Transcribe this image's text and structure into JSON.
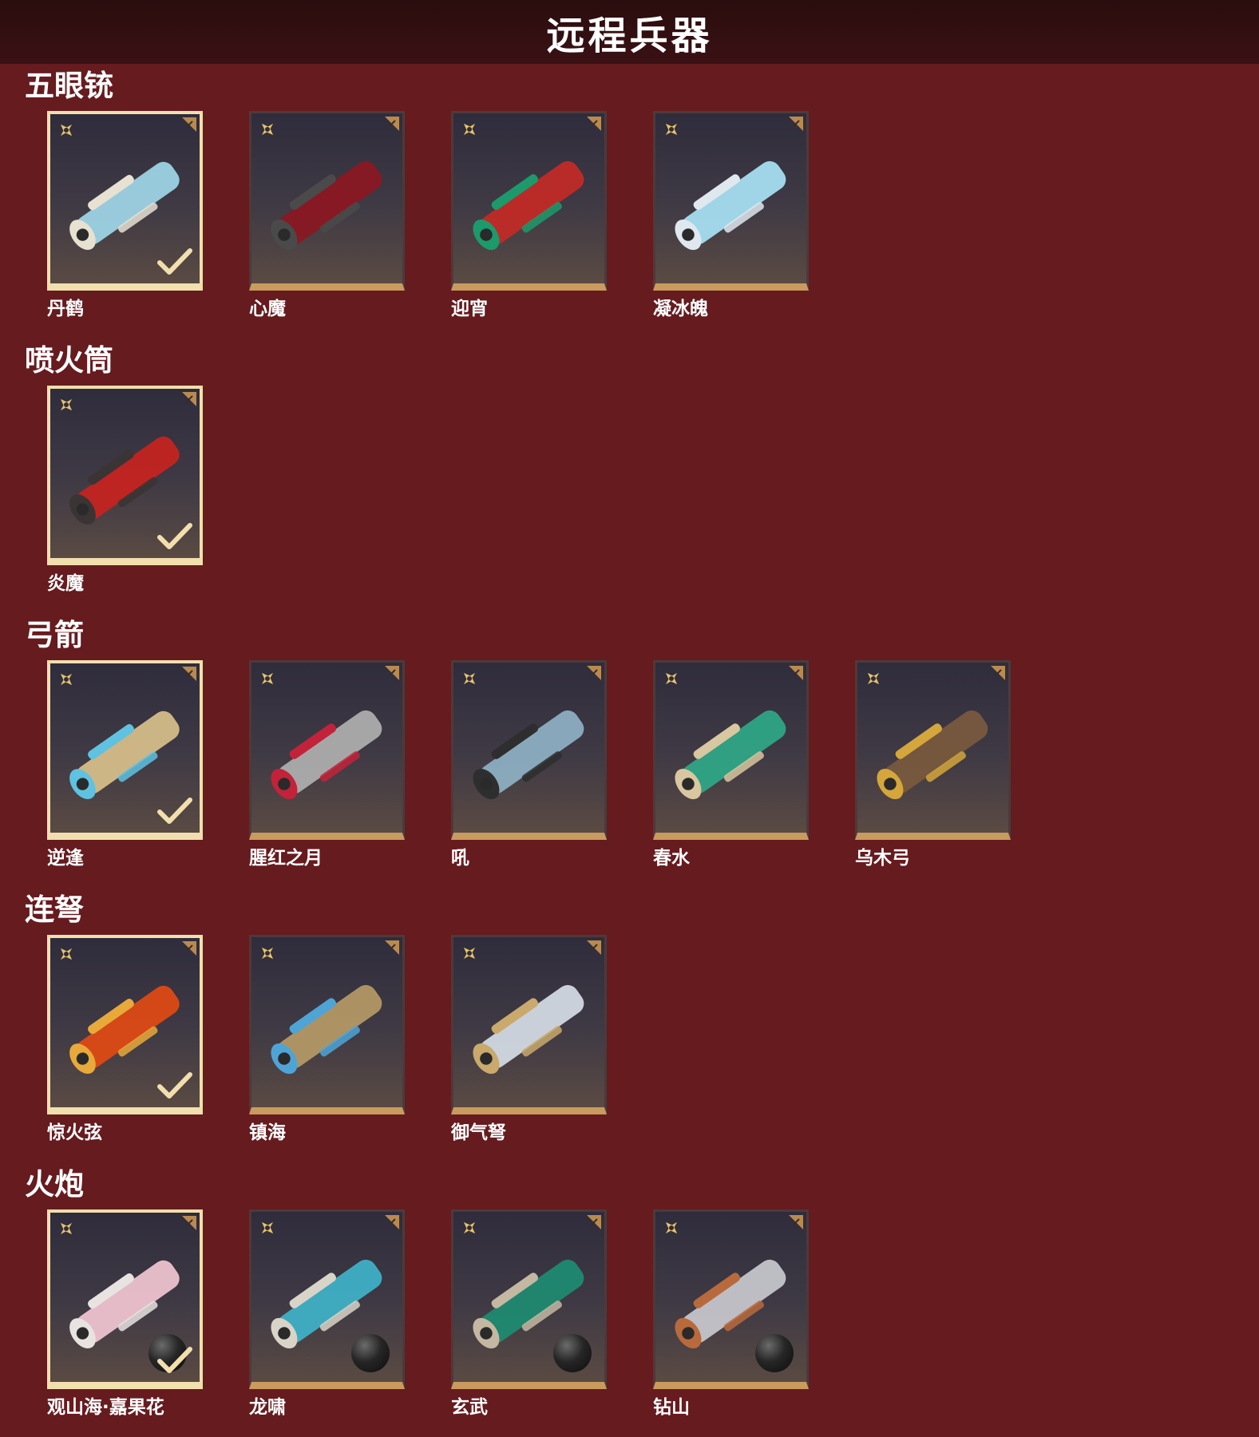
{
  "header": {
    "title": "远程兵器"
  },
  "sections": [
    {
      "title": "五眼铳",
      "items": [
        {
          "name": "丹鹤",
          "equipped": true,
          "primary": "#9fd7e8",
          "secondary": "#e7e1d2"
        },
        {
          "name": "心魔",
          "equipped": false,
          "primary": "#8c1722",
          "secondary": "#4a4a4a"
        },
        {
          "name": "迎宵",
          "equipped": false,
          "primary": "#c42a26",
          "secondary": "#1c9a6b"
        },
        {
          "name": "凝冰魄",
          "equipped": false,
          "primary": "#a8e3f5",
          "secondary": "#dfe8ee"
        }
      ]
    },
    {
      "title": "喷火筒",
      "items": [
        {
          "name": "炎魔",
          "equipped": true,
          "primary": "#c8231f",
          "secondary": "#3a3434"
        }
      ]
    },
    {
      "title": "弓箭",
      "items": [
        {
          "name": "逆逢",
          "equipped": true,
          "primary": "#d9c08b",
          "secondary": "#5fc2e0"
        },
        {
          "name": "腥红之月",
          "equipped": false,
          "primary": "#b0b0b0",
          "secondary": "#c2233a"
        },
        {
          "name": "吼",
          "equipped": false,
          "primary": "#8fb1c4",
          "secondary": "#2e2e2e"
        },
        {
          "name": "春水",
          "equipped": false,
          "primary": "#2fa888",
          "secondary": "#d8c7a0"
        },
        {
          "name": "乌木弓",
          "equipped": false,
          "primary": "#7a5a3e",
          "secondary": "#d4a63b"
        }
      ]
    },
    {
      "title": "连弩",
      "items": [
        {
          "name": "惊火弦",
          "equipped": true,
          "primary": "#e24a14",
          "secondary": "#e8a93b"
        },
        {
          "name": "镇海",
          "equipped": false,
          "primary": "#b69a66",
          "secondary": "#4fa4d6"
        },
        {
          "name": "御气弩",
          "equipped": false,
          "primary": "#d6dde6",
          "secondary": "#c9a96c"
        }
      ]
    },
    {
      "title": "火炮",
      "items": [
        {
          "name": "观山海·嘉果花",
          "equipped": true,
          "primary": "#f2c7d3",
          "secondary": "#e8e3e1",
          "cannonball": true
        },
        {
          "name": "龙啸",
          "equipped": false,
          "primary": "#3fb3c9",
          "secondary": "#d9d4c8",
          "cannonball": true
        },
        {
          "name": "玄武",
          "equipped": false,
          "primary": "#1e8c72",
          "secondary": "#c4b8a2",
          "cannonball": true
        },
        {
          "name": "钻山",
          "equipped": false,
          "primary": "#c9c9cf",
          "secondary": "#b86a3c",
          "cannonball": true
        }
      ]
    }
  ]
}
